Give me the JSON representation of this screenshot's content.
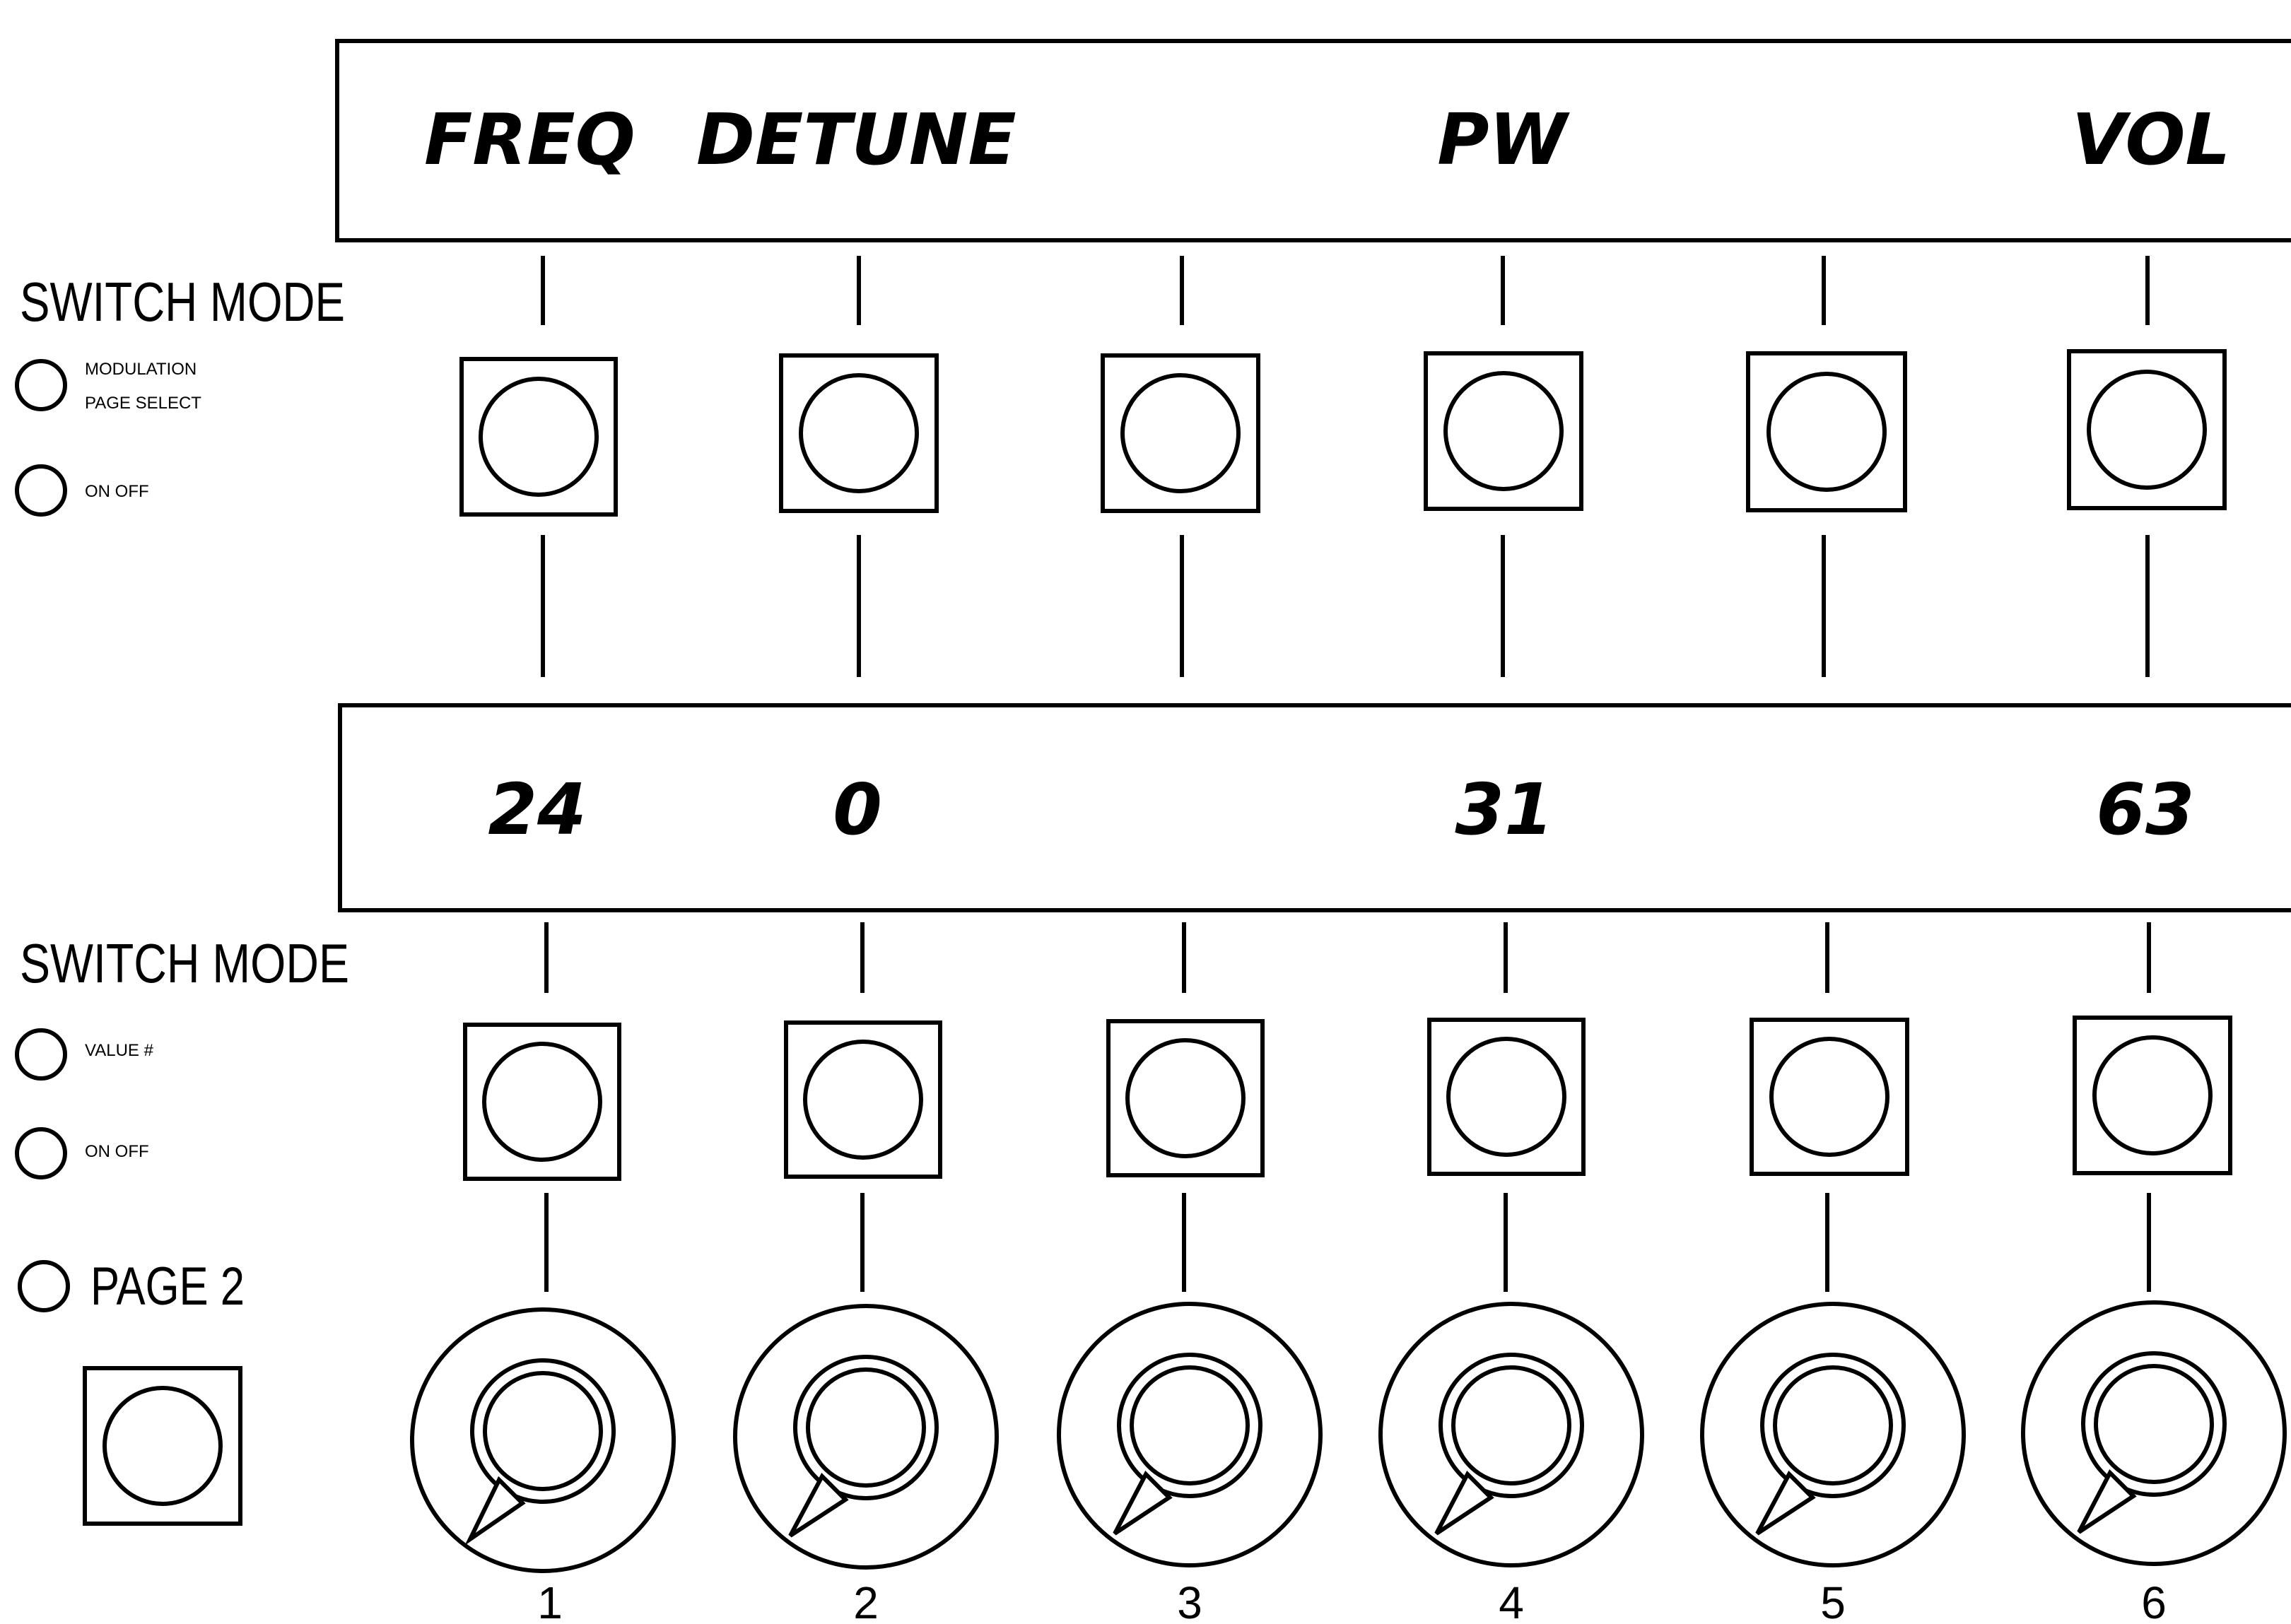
{
  "top_display": {
    "labels": [
      "FREQ",
      "DETUNE",
      "",
      "PW",
      "",
      "VOL"
    ]
  },
  "bottom_display": {
    "values": [
      "24",
      "0",
      "",
      "31",
      "",
      "63"
    ]
  },
  "top_switch_mode": {
    "heading": "SWITCH MODE",
    "options": [
      "MODULATION",
      "PAGE SELECT",
      "ON OFF"
    ]
  },
  "bottom_switch_mode": {
    "heading": "SWITCH MODE",
    "options": [
      "VALUE #",
      "ON OFF"
    ]
  },
  "page_indicator": {
    "label": "PAGE 2"
  },
  "knobs": {
    "numbers": [
      "1",
      "2",
      "3",
      "4",
      "5",
      "6"
    ]
  },
  "colors": {
    "ink": "#000000",
    "background": "#ffffff"
  }
}
